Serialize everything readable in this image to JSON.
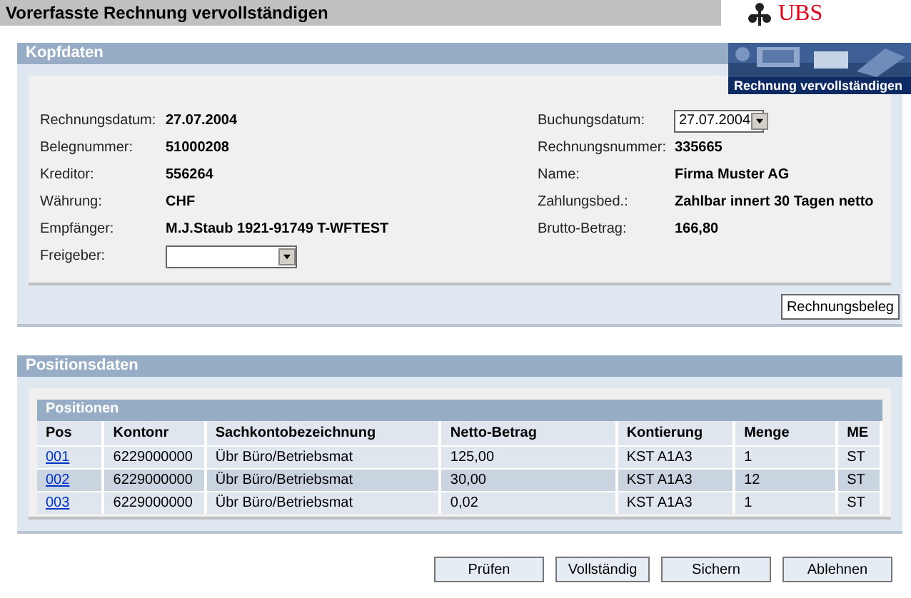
{
  "title": "Vorerfasste Rechnung vervollständigen",
  "logo": "UBS",
  "kopfdaten": {
    "title": "Kopfdaten",
    "banner_caption": "Rechnung vervollständigen",
    "left": [
      {
        "label": "Rechnungsdatum:",
        "value": "27.07.2004",
        "kind": "text"
      },
      {
        "label": "Belegnummer:",
        "value": "51000208",
        "kind": "text"
      },
      {
        "label": "Kreditor:",
        "value": "556264",
        "kind": "text"
      },
      {
        "label": "Währung:",
        "value": "CHF",
        "kind": "text"
      },
      {
        "label": "Empfänger:",
        "value": "M.J.Staub 1921-91749 T-WFTEST",
        "kind": "text"
      },
      {
        "label": "Freigeber:",
        "kind": "select"
      }
    ],
    "right": [
      {
        "label": "Buchungsdatum:",
        "value": "27.07.2004",
        "kind": "select"
      },
      {
        "label": "Rechnungsnummer:",
        "value": "335665",
        "kind": "text"
      },
      {
        "label": "Name:",
        "value": "Firma Muster AG",
        "kind": "text"
      },
      {
        "label": "Zahlungsbed.:",
        "value": "Zahlbar innert 30 Tagen netto",
        "kind": "text"
      },
      {
        "label": "Brutto-Betrag:",
        "value": "166,80",
        "kind": "text"
      }
    ],
    "button": "Rechnungsbeleg"
  },
  "positionsdaten": {
    "title": "Positionsdaten",
    "table_title": "Positionen",
    "columns": [
      "Pos",
      "Kontonr",
      "Sachkontobezeichnung",
      "Netto-Betrag",
      "Kontierung",
      "Menge",
      "ME"
    ],
    "rows": [
      [
        "001",
        "6229000000",
        "Übr Büro/Betriebsmat",
        "125,00",
        "KST A1A3",
        "1",
        "ST"
      ],
      [
        "002",
        "6229000000",
        "Übr Büro/Betriebsmat",
        "30,00",
        "KST A1A3",
        "12",
        "ST"
      ],
      [
        "003",
        "6229000000",
        "Übr Büro/Betriebsmat",
        "0,02",
        "KST A1A3",
        "1",
        "ST"
      ]
    ]
  },
  "buttons": [
    "Prüfen",
    "Vollständig",
    "Sichern",
    "Ablehnen"
  ]
}
